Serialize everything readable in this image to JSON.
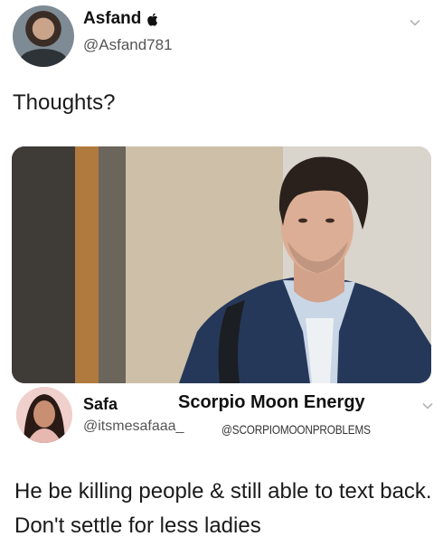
{
  "tweet": {
    "author_name": "Asfand",
    "author_handle": "@Asfand781",
    "text": "Thoughts?"
  },
  "reply": {
    "author_name": "Safa",
    "author_handle": "@itsmesafaaa_",
    "title": "Scorpio Moon Energy",
    "tag": "@SCORPIOMOONPROBLEMS",
    "text": "He be killing people & still able to text back. Don't settle for less ladies"
  },
  "icons": {
    "badge": "apple-icon",
    "menu": "chevron-down-icon"
  }
}
